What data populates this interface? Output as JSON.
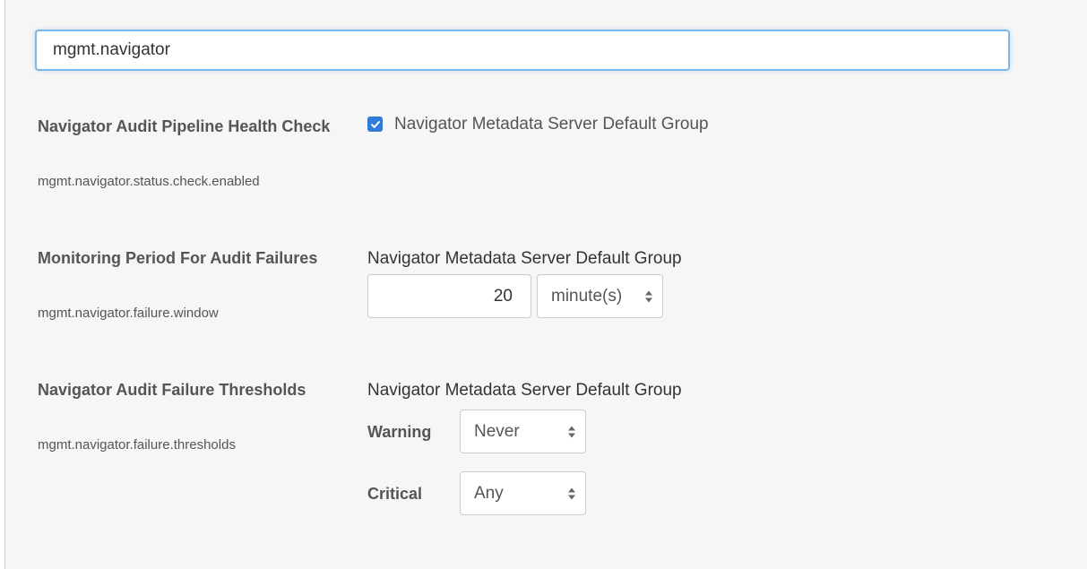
{
  "search": {
    "value": "mgmt.navigator",
    "placeholder": ""
  },
  "properties": [
    {
      "title": "Navigator Audit Pipeline Health Check",
      "key": "mgmt.navigator.status.check.enabled",
      "checked": true,
      "scope_label": "Navigator Metadata Server Default Group"
    },
    {
      "title": "Monitoring Period For Audit Failures",
      "key": "mgmt.navigator.failure.window",
      "scope_label": "Navigator Metadata Server Default Group",
      "value": "20",
      "unit": "minute(s)"
    },
    {
      "title": "Navigator Audit Failure Thresholds",
      "key": "mgmt.navigator.failure.thresholds",
      "scope_label": "Navigator Metadata Server Default Group",
      "warning_label": "Warning",
      "warning_value": "Never",
      "critical_label": "Critical",
      "critical_value": "Any"
    }
  ],
  "colors": {
    "accent": "#2f7bd9",
    "focus_border": "#7eb8e6",
    "panel_bg": "#f6f6f6"
  },
  "icons": {
    "checkbox": "checkmark-icon",
    "select_arrows": "sort-arrows-icon"
  }
}
